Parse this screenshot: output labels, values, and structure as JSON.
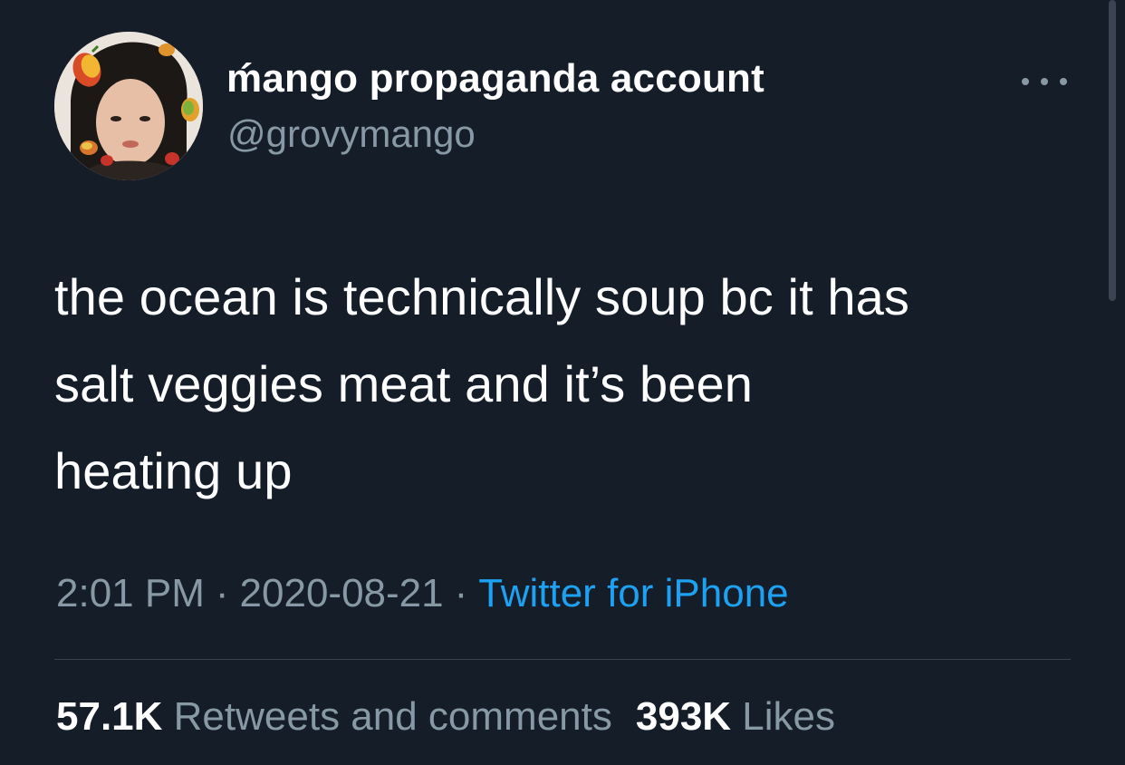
{
  "author": {
    "display_name": "ḿango propaganda account",
    "handle": "@grovymango"
  },
  "tweet": {
    "text_lines": [
      "the ocean is technically soup bc it has",
      "salt veggies meat and it’s been",
      "heating up"
    ],
    "time": "2:01 PM",
    "date": "2020-08-21",
    "separator": "·",
    "source": "Twitter for iPhone"
  },
  "stats": {
    "retweets_count": "57.1K",
    "retweets_label": "Retweets and comments",
    "likes_count": "393K",
    "likes_label": "Likes"
  },
  "icons": {
    "more": "more-options-icon",
    "avatar": "profile-avatar"
  },
  "colors": {
    "background": "#151d28",
    "primary_text": "#ffffff",
    "secondary_text": "#8899a6",
    "link": "#1da1f2",
    "divider": "#38444d"
  }
}
